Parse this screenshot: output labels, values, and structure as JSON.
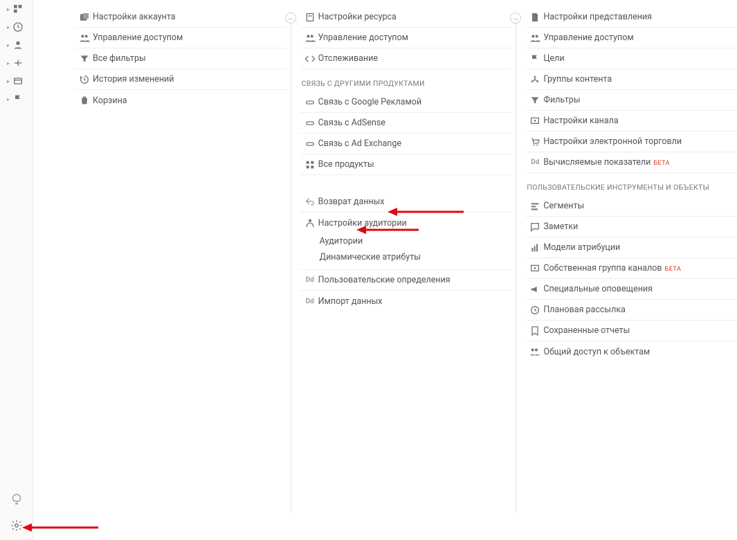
{
  "account": {
    "items": [
      {
        "icon": "account-settings",
        "label": "Настройки аккаунта"
      },
      {
        "icon": "users",
        "label": "Управление доступом"
      },
      {
        "icon": "filter",
        "label": "Все фильтры"
      },
      {
        "icon": "history",
        "label": "История изменений"
      },
      {
        "icon": "trash",
        "label": "Корзина"
      }
    ]
  },
  "property": {
    "items_top": [
      {
        "icon": "resource",
        "label": "Настройки ресурса"
      },
      {
        "icon": "users",
        "label": "Управление доступом"
      },
      {
        "icon": "code",
        "label": "Отслеживание"
      }
    ],
    "link_section": "СВЯЗЬ С ДРУГИМИ ПРОДУКТАМИ",
    "items_link": [
      {
        "icon": "link",
        "label": "Связь с Google Рекламой"
      },
      {
        "icon": "link",
        "label": "Связь с AdSense"
      },
      {
        "icon": "link",
        "label": "Связь с Ad Exchange"
      },
      {
        "icon": "apps",
        "label": "Все продукты"
      }
    ],
    "items_aud": [
      {
        "icon": "return",
        "label": "Возврат данных"
      },
      {
        "icon": "audience",
        "label": "Настройки аудитории"
      }
    ],
    "sub_aud": [
      "Аудитории",
      "Динамические атрибуты"
    ],
    "items_dd": [
      {
        "icon": "dd",
        "label": "Пользовательские определения"
      },
      {
        "icon": "dd",
        "label": "Импорт данных"
      }
    ]
  },
  "view": {
    "items_top": [
      {
        "icon": "page",
        "label": "Настройки представления"
      },
      {
        "icon": "users",
        "label": "Управление доступом"
      },
      {
        "icon": "flag",
        "label": "Цели"
      },
      {
        "icon": "content",
        "label": "Группы контента"
      },
      {
        "icon": "filter",
        "label": "Фильтры"
      },
      {
        "icon": "channel",
        "label": "Настройки канала"
      },
      {
        "icon": "cart",
        "label": "Настройки электронной торговли"
      },
      {
        "icon": "dd",
        "label": "Вычисляемые показатели",
        "beta": "БЕТА"
      }
    ],
    "tools_section": "ПОЛЬЗОВАТЕЛЬСКИЕ ИНСТРУМЕНТЫ И ОБЪЕКТЫ",
    "items_tools": [
      {
        "icon": "segments",
        "label": "Сегменты"
      },
      {
        "icon": "notes",
        "label": "Заметки"
      },
      {
        "icon": "attribution",
        "label": "Модели атрибуции"
      },
      {
        "icon": "channel",
        "label": "Собственная группа каналов",
        "beta": "БЕТА"
      },
      {
        "icon": "megaphone",
        "label": "Специальные оповещения"
      },
      {
        "icon": "schedule",
        "label": "Плановая рассылка"
      },
      {
        "icon": "saved",
        "label": "Сохраненные отчеты"
      },
      {
        "icon": "share",
        "label": "Общий доступ к объектам"
      }
    ]
  }
}
